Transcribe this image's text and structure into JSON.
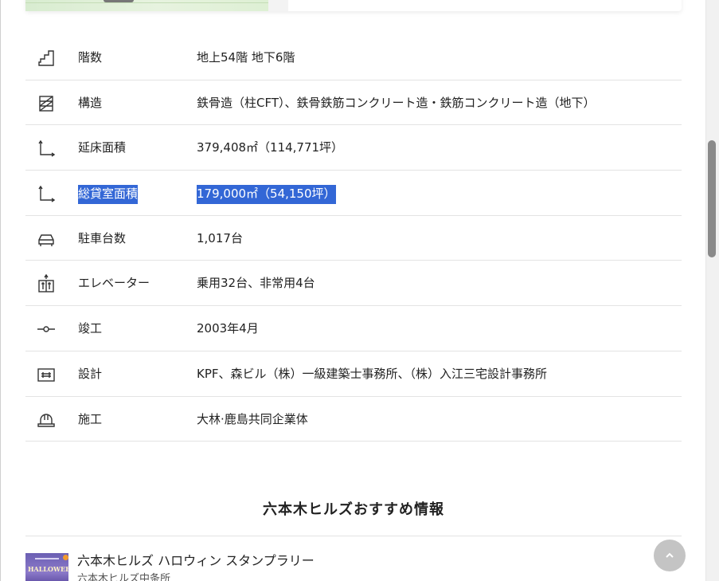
{
  "specs": [
    {
      "icon": "stairs-icon",
      "label": "階数",
      "value": "地上54階 地下6階",
      "selected": false
    },
    {
      "icon": "structure-icon",
      "label": "構造",
      "value": "鉄骨造（柱CFT）、鉄骨鉄筋コンクリート造・鉄筋コンクリート造（地下）",
      "selected": false
    },
    {
      "icon": "area-axes-icon",
      "label": "延床面積",
      "value": "379,408㎡（114,771坪）",
      "selected": false
    },
    {
      "icon": "area-axes-icon",
      "label": "総貸室面積",
      "value": "179,000㎡（54,150坪）",
      "selected": true
    },
    {
      "icon": "car-icon",
      "label": "駐車台数",
      "value": "1,017台",
      "selected": false
    },
    {
      "icon": "elevator-icon",
      "label": "エレベーター",
      "value": "乗用32台、非常用4台",
      "selected": false
    },
    {
      "icon": "completion-icon",
      "label": "竣工",
      "value": "2003年4月",
      "selected": false
    },
    {
      "icon": "blueprint-icon",
      "label": "設計",
      "value": "KPF、森ビル（株）一級建築士事務所、（株）入江三宅設計事務所",
      "selected": false
    },
    {
      "icon": "hardhat-icon",
      "label": "施工",
      "value": "大林·鹿島共同企業体",
      "selected": false
    }
  ],
  "recommend": {
    "title": "六本木ヒルズおすすめ情報",
    "items": [
      {
        "thumb_text": "HALLOWEEN",
        "title": "六本木ヒルズ ハロウィン スタンプラリー",
        "subtitle": "六本木ヒルズ中条所"
      }
    ]
  },
  "back_to_top": {
    "icon": "chevron-up-icon"
  },
  "colors": {
    "selection": "#3367d6",
    "divider": "#e3e3e3",
    "button": "#c4c4c4"
  }
}
